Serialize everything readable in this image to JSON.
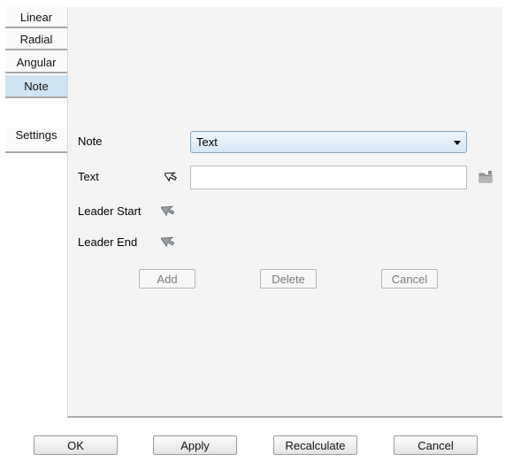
{
  "tabs": [
    {
      "label": "Linear"
    },
    {
      "label": "Radial"
    },
    {
      "label": "Angular"
    },
    {
      "label": "Note",
      "active": true
    },
    {
      "label": "Settings"
    }
  ],
  "form": {
    "note_label": "Note",
    "note_value": "Text",
    "text_label": "Text",
    "text_value": "",
    "leader_start_label": "Leader Start",
    "leader_end_label": "Leader End"
  },
  "actions": {
    "add": "Add",
    "delete": "Delete",
    "cancel": "Cancel"
  },
  "footer": {
    "ok": "OK",
    "apply": "Apply",
    "recalculate": "Recalculate",
    "cancel": "Cancel"
  },
  "icons": {
    "text_pick": "arrow-cursor-outline-icon",
    "text_browse": "folder-icon",
    "leader_start_pick": "arrow-cursor-icon",
    "leader_end_pick": "arrow-cursor-icon"
  },
  "colors": {
    "active_tab": "#cfe4f2",
    "panel": "#f4f4f4",
    "select_gradient_bottom": "#d5e7f5"
  }
}
